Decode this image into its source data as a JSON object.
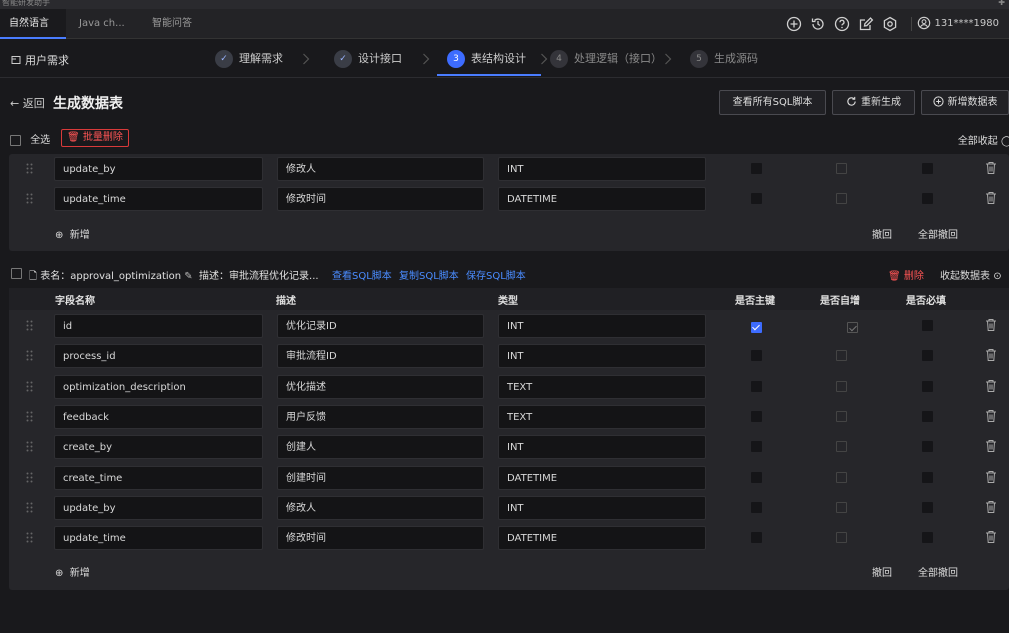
{
  "window": {
    "title": "智能研发助手"
  },
  "tabs": [
    {
      "label": "自然语言",
      "active": true
    },
    {
      "label": "Java ch...",
      "active": false
    },
    {
      "label": "智能问答",
      "active": false
    }
  ],
  "toolbar": {
    "icons": [
      "plus-circle-icon",
      "history-icon",
      "help-icon",
      "edit-icon",
      "settings-icon"
    ],
    "user": "131****1980"
  },
  "steps": {
    "requirement_label": "用户需求",
    "items": [
      {
        "num": "✓",
        "label": "理解需求",
        "state": "done"
      },
      {
        "num": "✓",
        "label": "设计接口",
        "state": "done"
      },
      {
        "num": "3",
        "label": "表结构设计",
        "state": "current"
      },
      {
        "num": "4",
        "label": "处理逻辑（接口）",
        "state": "todo"
      },
      {
        "num": "5",
        "label": "生成源码",
        "state": "todo"
      }
    ]
  },
  "header": {
    "back_label": "返回",
    "title": "生成数据表",
    "view_sql_label": "查看所有SQL脚本",
    "regen_label": "重新生成",
    "add_table_label": "新增数据表"
  },
  "bulk": {
    "select_all_label": "全选",
    "batch_delete_label": "批量删除",
    "collapse_all_label": "全部收起"
  },
  "table1": {
    "rows": [
      {
        "name": "update_by",
        "desc": "修改人",
        "type": "INT",
        "pk": false,
        "auto": false,
        "req": false
      },
      {
        "name": "update_time",
        "desc": "修改时间",
        "type": "DATETIME",
        "pk": false,
        "auto": false,
        "req": false
      }
    ],
    "add_label": "新增",
    "undo_label": "撤回",
    "undo_all_label": "全部撤回"
  },
  "table2": {
    "name_prefix": "表名：",
    "name": "approval_optimization",
    "desc_prefix": "描述：",
    "desc": "审批流程优化记录...",
    "view_sql_label": "查看SQL脚本",
    "copy_sql_label": "复制SQL脚本",
    "save_sql_label": "保存SQL脚本",
    "delete_label": "删除",
    "collapse_label": "收起数据表",
    "columns": {
      "name": "字段名称",
      "desc": "描述",
      "type": "类型",
      "pk": "是否主键",
      "auto": "是否自增",
      "req": "是否必填"
    },
    "rows": [
      {
        "name": "id",
        "desc": "优化记录ID",
        "type": "INT",
        "pk": true,
        "auto": true,
        "req": false
      },
      {
        "name": "process_id",
        "desc": "审批流程ID",
        "type": "INT",
        "pk": false,
        "auto": false,
        "req": false
      },
      {
        "name": "optimization_description",
        "desc": "优化描述",
        "type": "TEXT",
        "pk": false,
        "auto": false,
        "req": false
      },
      {
        "name": "feedback",
        "desc": "用户反馈",
        "type": "TEXT",
        "pk": false,
        "auto": false,
        "req": false
      },
      {
        "name": "create_by",
        "desc": "创建人",
        "type": "INT",
        "pk": false,
        "auto": false,
        "req": false
      },
      {
        "name": "create_time",
        "desc": "创建时间",
        "type": "DATETIME",
        "pk": false,
        "auto": false,
        "req": false
      },
      {
        "name": "update_by",
        "desc": "修改人",
        "type": "INT",
        "pk": false,
        "auto": false,
        "req": false
      },
      {
        "name": "update_time",
        "desc": "修改时间",
        "type": "DATETIME",
        "pk": false,
        "auto": false,
        "req": false
      }
    ],
    "add_label": "新增",
    "undo_label": "撤回",
    "undo_all_label": "全部撤回"
  },
  "colors": {
    "accent": "#3d6cff",
    "danger": "#ff5555",
    "link": "#4a8cff"
  }
}
